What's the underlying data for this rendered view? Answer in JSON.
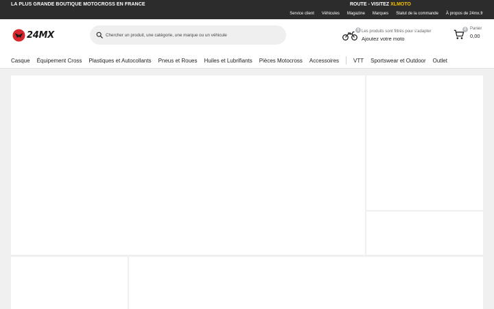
{
  "topbar": {
    "promo_left": "LA PLUS GRANDE BOUTIQUE MOTOCROSS EN FRANCE",
    "promo_right_prefix": "ROUTE - VISITEZ ",
    "promo_right_brand": "XLMOTO",
    "links": [
      {
        "label": "Service client"
      },
      {
        "label": "Véhicules"
      },
      {
        "label": "Magazine"
      },
      {
        "label": "Marques"
      },
      {
        "label": "Statut de la commande"
      },
      {
        "label": "À propos de 24mx.fr"
      }
    ]
  },
  "header": {
    "logo_text": "24MX",
    "search_placeholder": "Chercher un produit, une catégorie, une marque ou un véhicule",
    "vehicle": {
      "count": "0",
      "line1": "Les produits sont filtrés pour s'adapter",
      "line2": "Ajoutez votre moto"
    },
    "cart": {
      "count": "0",
      "label": "Panier",
      "total": "0,00"
    }
  },
  "nav": {
    "primary": [
      {
        "label": "Casque"
      },
      {
        "label": "Équipement Cross"
      },
      {
        "label": "Plastiques et Autocollants"
      },
      {
        "label": "Pneus et Roues"
      },
      {
        "label": "Huiles et Lubrifiants"
      },
      {
        "label": "Pièces Motocross"
      },
      {
        "label": "Accessoires"
      }
    ],
    "secondary": [
      {
        "label": "VTT"
      },
      {
        "label": "Sportswear et Outdoor"
      },
      {
        "label": "Outlet"
      }
    ]
  },
  "colors": {
    "topbar_bg": "#2c2c2c",
    "accent_yellow": "#f5c400",
    "logo_red": "#d7262e",
    "page_bg": "#f0f0f0"
  }
}
